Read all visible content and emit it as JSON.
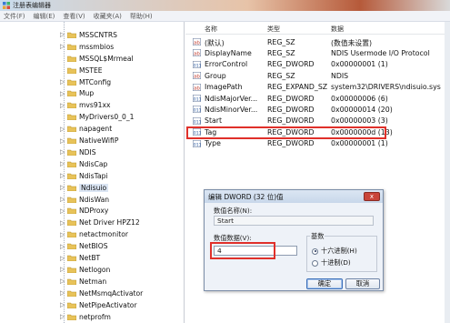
{
  "window": {
    "title": "注册表编辑器"
  },
  "menu": [
    "文件(F)",
    "编辑(E)",
    "查看(V)",
    "收藏夹(A)",
    "帮助(H)"
  ],
  "tree": {
    "items": [
      {
        "label": "MSSCNTRS",
        "expandable": true
      },
      {
        "label": "mssmbios",
        "expandable": true
      },
      {
        "label": "MSSQL$Mrmeal",
        "expandable": false
      },
      {
        "label": "MSTEE",
        "expandable": false
      },
      {
        "label": "MTConfig",
        "expandable": true
      },
      {
        "label": "Mup",
        "expandable": true
      },
      {
        "label": "mvs91xx",
        "expandable": true
      },
      {
        "label": "MyDrivers0_0_1",
        "expandable": false
      },
      {
        "label": "napagent",
        "expandable": true
      },
      {
        "label": "NativeWifiP",
        "expandable": true
      },
      {
        "label": "NDIS",
        "expandable": true
      },
      {
        "label": "NdisCap",
        "expandable": true
      },
      {
        "label": "NdisTapi",
        "expandable": true
      },
      {
        "label": "Ndisuio",
        "expandable": true,
        "selected": true
      },
      {
        "label": "NdisWan",
        "expandable": true
      },
      {
        "label": "NDProxy",
        "expandable": true
      },
      {
        "label": "Net Driver HPZ12",
        "expandable": true
      },
      {
        "label": "netactmonitor",
        "expandable": true
      },
      {
        "label": "NetBIOS",
        "expandable": true
      },
      {
        "label": "NetBT",
        "expandable": true
      },
      {
        "label": "Netlogon",
        "expandable": true
      },
      {
        "label": "Netman",
        "expandable": true
      },
      {
        "label": "NetMsmqActivator",
        "expandable": true
      },
      {
        "label": "NetPipeActivator",
        "expandable": true
      },
      {
        "label": "netprofm",
        "expandable": true
      }
    ]
  },
  "list": {
    "headers": {
      "name": "名称",
      "type": "类型",
      "data": "数据"
    },
    "rows": [
      {
        "name": "(默认)",
        "type": "REG_SZ",
        "data": "(数值未设置)",
        "icon": "ab"
      },
      {
        "name": "DisplayName",
        "type": "REG_SZ",
        "data": "NDIS Usermode I/O Protocol",
        "icon": "ab"
      },
      {
        "name": "ErrorControl",
        "type": "REG_DWORD",
        "data": "0x00000001 (1)",
        "icon": "bin"
      },
      {
        "name": "Group",
        "type": "REG_SZ",
        "data": "NDIS",
        "icon": "ab"
      },
      {
        "name": "ImagePath",
        "type": "REG_EXPAND_SZ",
        "data": "system32\\DRIVERS\\ndisuio.sys",
        "icon": "ab"
      },
      {
        "name": "NdisMajorVer...",
        "type": "REG_DWORD",
        "data": "0x00000006 (6)",
        "icon": "bin"
      },
      {
        "name": "NdisMinorVer...",
        "type": "REG_DWORD",
        "data": "0x00000014 (20)",
        "icon": "bin"
      },
      {
        "name": "Start",
        "type": "REG_DWORD",
        "data": "0x00000003 (3)",
        "icon": "bin",
        "highlighted": true
      },
      {
        "name": "Tag",
        "type": "REG_DWORD",
        "data": "0x0000000d (13)",
        "icon": "bin"
      },
      {
        "name": "Type",
        "type": "REG_DWORD",
        "data": "0x00000001 (1)",
        "icon": "bin"
      }
    ]
  },
  "dialog": {
    "title": "编辑 DWORD (32 位)值",
    "close_label": "x",
    "name_label": "数值名称(N):",
    "name_value": "Start",
    "data_label": "数值数据(V):",
    "data_value": "4",
    "base_label": "基数",
    "radio_hex": "十六进制(H)",
    "radio_dec": "十进制(D)",
    "base_selected": "hex",
    "ok_label": "确定",
    "cancel_label": "取消"
  },
  "colors": {
    "highlight": "#e0302a",
    "selection": "#dbe5f3"
  }
}
